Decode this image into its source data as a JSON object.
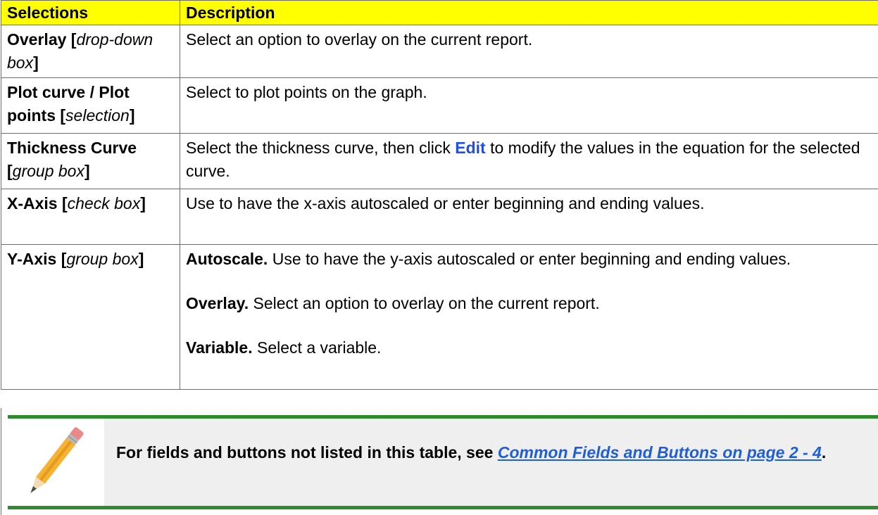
{
  "table": {
    "headers": [
      "Selections",
      "Description"
    ],
    "rows": [
      {
        "name": "Overlay [",
        "type": "drop-down box",
        "close": "]",
        "desc": "Select an option to overlay on the current report."
      },
      {
        "name": "Plot curve / Plot points [",
        "type": "selection",
        "close": "]",
        "desc": "Select to plot points on the graph."
      },
      {
        "name": "Thickness Curve [",
        "type": "group box",
        "close": "]",
        "desc_before": "Select the thickness curve, then click ",
        "desc_link": "Edit",
        "desc_after": " to modify the values in the equation for the selected curve."
      },
      {
        "name": "X-Axis [",
        "type": "check box",
        "close": "]",
        "desc": "Use to have the x-axis autoscaled or enter beginning and ending values."
      },
      {
        "name": "Y-Axis [",
        "type": "group box",
        "close": "]",
        "paragraphs": [
          {
            "lead": "Autoscale.",
            "text": " Use to have the y-axis autoscaled or enter beginning and ending values."
          },
          {
            "lead": "Overlay.",
            "text": " Select an option to overlay on the current report."
          },
          {
            "lead": "Variable.",
            "text": " Select a variable."
          }
        ]
      }
    ]
  },
  "note": {
    "icon": "pencil-icon",
    "text_before": "For fields and buttons not listed in this table, see ",
    "link": "Common Fields and Buttons on page 2 - 4",
    "text_after": "."
  },
  "colors": {
    "header_bg": "#ffff00",
    "note_rule": "#2d8a2d",
    "note_bg": "#efefef",
    "link": "#1f5fd6",
    "edit_highlight": "#1f4ee0"
  }
}
